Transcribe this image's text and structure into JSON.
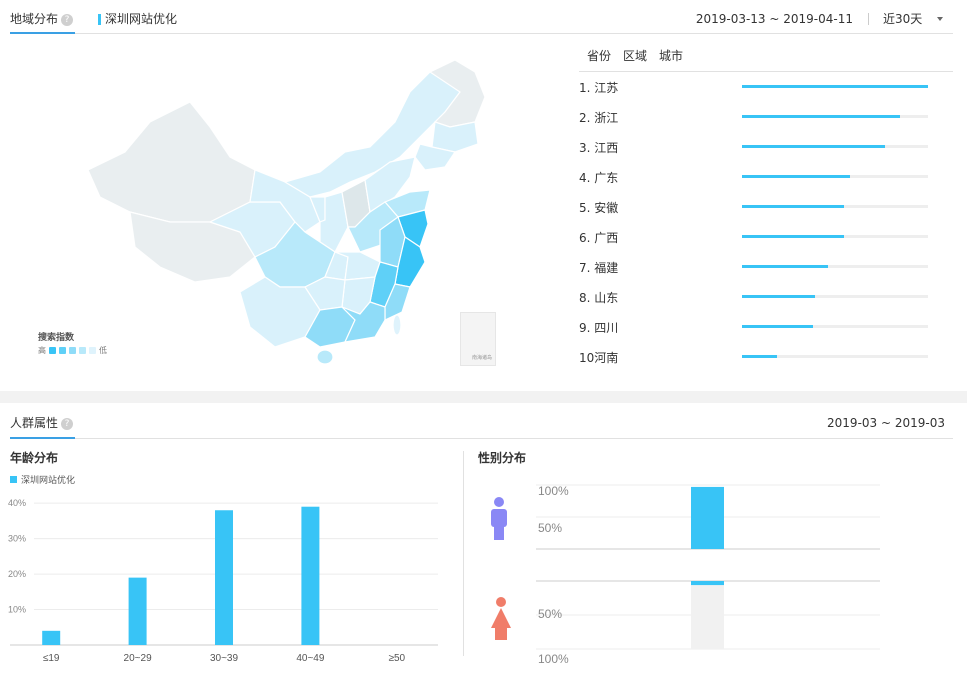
{
  "region_section": {
    "tab_title": "地域分布",
    "help_icon": "?",
    "keyword": "深圳网站优化",
    "date_range": "2019-03-13 ~ 2019-04-11",
    "period": "近30天",
    "legend": {
      "title": "搜索指数",
      "high": "高",
      "low": "低",
      "colors": [
        "#38c4f6",
        "#5fd0f7",
        "#8fdcf8",
        "#b8e9fa",
        "#dff3fc"
      ]
    },
    "inset_label": "南海诸岛",
    "rank_tabs": [
      "省份",
      "区域",
      "城市"
    ],
    "rankings": [
      {
        "label": "1. 江苏",
        "value": 1.0
      },
      {
        "label": "2. 浙江",
        "value": 0.85
      },
      {
        "label": "3. 江西",
        "value": 0.77
      },
      {
        "label": "4. 广东",
        "value": 0.58
      },
      {
        "label": "5. 安徽",
        "value": 0.55
      },
      {
        "label": "6. 广西",
        "value": 0.55
      },
      {
        "label": "7. 福建",
        "value": 0.46
      },
      {
        "label": "8. 山东",
        "value": 0.39
      },
      {
        "label": "9. 四川",
        "value": 0.38
      },
      {
        "label": "10河南",
        "value": 0.19
      }
    ],
    "colors": {
      "accent": "#38c4f6",
      "track": "#eeeeee"
    }
  },
  "crowd_section": {
    "tab_title": "人群属性",
    "help_icon": "?",
    "date_range": "2019-03 ~ 2019-03",
    "age_title": "年龄分布",
    "gender_title": "性别分布"
  },
  "chart_data": [
    {
      "type": "bar",
      "title": "年龄分布",
      "categories": [
        "≤19",
        "20~29",
        "30~39",
        "40~49",
        "≥50"
      ],
      "series": [
        {
          "name": "深圳网站优化",
          "values": [
            4,
            19,
            38,
            39,
            0
          ]
        }
      ],
      "ylim": [
        0,
        40
      ],
      "yticks": [
        "10%",
        "20%",
        "30%",
        "40%"
      ],
      "grid": true,
      "legend": "top-left",
      "color": "#38c4f6"
    },
    {
      "type": "bar",
      "title": "性别分布",
      "categories": [
        "男",
        "女"
      ],
      "values": [
        97,
        3
      ],
      "axis_labels": {
        "male": [
          "100%",
          "50%"
        ],
        "female": [
          "50%",
          "100%"
        ]
      },
      "icons": [
        "male-icon",
        "female-icon"
      ],
      "colors": {
        "male": "#8a88f5",
        "female": "#f07d69",
        "bar": "#38c4f6",
        "remainder": "#f1f1f1"
      }
    }
  ]
}
